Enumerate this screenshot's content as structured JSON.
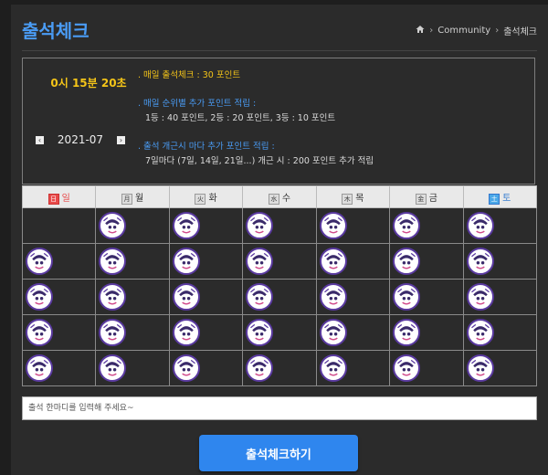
{
  "header": {
    "title": "출석체크",
    "breadcrumb": [
      "Community",
      "출석체크"
    ]
  },
  "info": {
    "clock": "0시 15분 20초",
    "month": "2021-07",
    "prev_label": "‹",
    "next_label": "›",
    "rules": [
      {
        "title": ". 매일 출석체크 : 30 포인트",
        "detail": ""
      },
      {
        "title": ". 매일 순위별 추가 포인트 적립 :",
        "detail": "1등 : 40 포인트,  2등 : 20 포인트,  3등 : 10 포인트"
      },
      {
        "title": ". 출석 개근시 마다 추가 포인트 적립 :",
        "detail": "7일마다 (7일, 14일, 21일...) 개근 시 : 200 포인트 추가 적립"
      }
    ]
  },
  "calendar": {
    "weekdays": [
      {
        "badge": "日",
        "name": "일"
      },
      {
        "badge": "月",
        "name": "월"
      },
      {
        "badge": "火",
        "name": "화"
      },
      {
        "badge": "水",
        "name": "수"
      },
      {
        "badge": "木",
        "name": "목"
      },
      {
        "badge": "金",
        "name": "금"
      },
      {
        "badge": "土",
        "name": "토"
      }
    ],
    "stamps": [
      [
        false,
        true,
        true,
        true,
        true,
        true,
        true
      ],
      [
        true,
        true,
        true,
        true,
        true,
        true,
        true
      ],
      [
        true,
        true,
        true,
        true,
        true,
        true,
        true
      ],
      [
        true,
        true,
        true,
        true,
        true,
        true,
        true
      ],
      [
        true,
        true,
        true,
        true,
        true,
        true,
        true
      ]
    ]
  },
  "comment": {
    "placeholder": "출석 한마디를 입력해 주세요~"
  },
  "submit": {
    "label": "출석체크하기"
  }
}
